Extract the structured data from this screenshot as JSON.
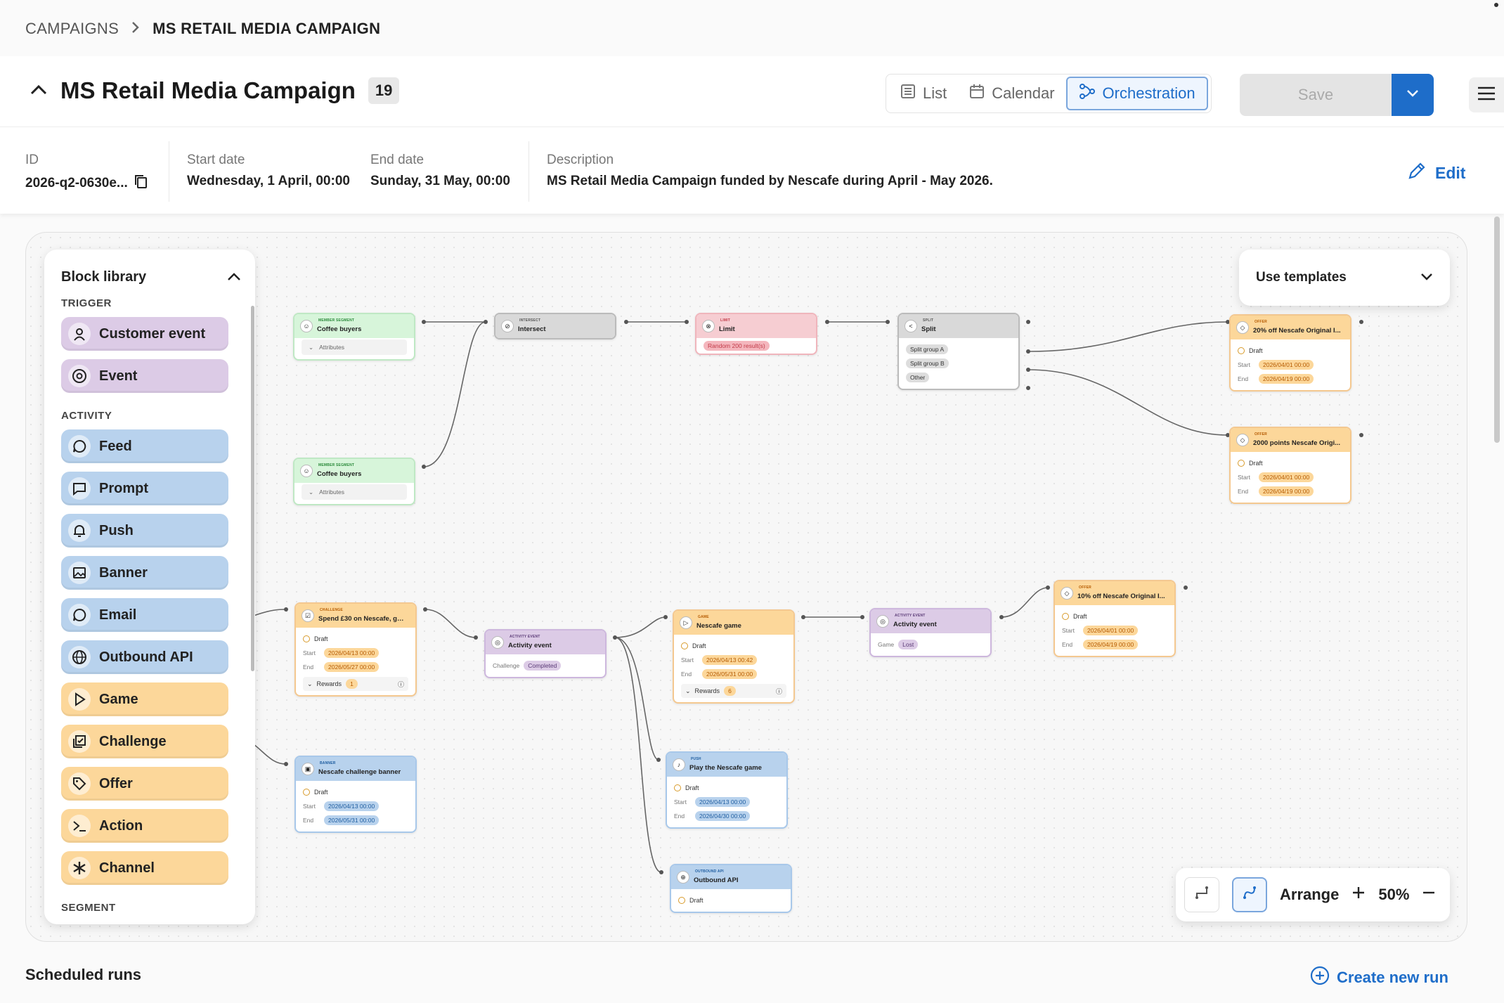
{
  "breadcrumb": {
    "root": "CAMPAIGNS",
    "current": "MS RETAIL MEDIA CAMPAIGN"
  },
  "header": {
    "title": "MS Retail Media Campaign",
    "count": "19",
    "views": [
      "List",
      "Calendar",
      "Orchestration"
    ],
    "save": "Save"
  },
  "info": {
    "id_label": "ID",
    "id_value": "2026-q2-0630e...",
    "start_label": "Start date",
    "start_value": "Wednesday, 1 April, 00:00",
    "end_label": "End date",
    "end_value": "Sunday, 31 May, 00:00",
    "desc_label": "Description",
    "desc_value": "MS Retail Media Campaign funded by Nescafe during April - May 2026.",
    "edit": "Edit"
  },
  "library": {
    "title": "Block library",
    "sections": {
      "trigger": "TRIGGER",
      "activity": "ACTIVITY",
      "segment": "SEGMENT"
    },
    "trigger": [
      "Customer event",
      "Event"
    ],
    "activity": [
      "Feed",
      "Prompt",
      "Push",
      "Banner",
      "Email",
      "Outbound API",
      "Game",
      "Challenge",
      "Offer",
      "Action",
      "Channel"
    ]
  },
  "templates": "Use templates",
  "tools": {
    "arrange": "Arrange",
    "zoom": "50%"
  },
  "nodes": {
    "seg1": {
      "type": "MEMBER SEGMENT",
      "name": "Coffee buyers",
      "attr": "Attributes"
    },
    "seg2": {
      "type": "MEMBER SEGMENT",
      "name": "Coffee buyers",
      "attr": "Attributes"
    },
    "intersect": {
      "type": "INTERSECT",
      "name": "Intersect"
    },
    "limit": {
      "type": "LIMIT",
      "name": "Limit",
      "pill": "Random 200 result(s)"
    },
    "split": {
      "type": "SPLIT",
      "name": "Split",
      "groups": [
        "Split group A",
        "Split group B",
        "Other"
      ]
    },
    "offer1": {
      "type": "OFFER",
      "name": "20% off Nescafe Original I...",
      "status": "Draft",
      "start": "2026/04/01 00:00",
      "end": "2026/04/19 00:00"
    },
    "offer2": {
      "type": "OFFER",
      "name": "2000 points Nescafe Origi...",
      "status": "Draft",
      "start": "2026/04/01 00:00",
      "end": "2026/04/19 00:00"
    },
    "challenge": {
      "type": "CHALLENGE",
      "name": "Spend £30 on Nescafe, ge...",
      "status": "Draft",
      "start": "2026/04/13 00:00",
      "end": "2026/05/27 00:00",
      "rewards": "Rewards",
      "rcount": "1"
    },
    "banner": {
      "type": "BANNER",
      "name": "Nescafe challenge banner",
      "status": "Draft",
      "start": "2026/04/13 00:00",
      "end": "2026/05/31 00:00"
    },
    "act1": {
      "type": "ACTIVITY EVENT",
      "name": "Activity event",
      "label": "Challenge",
      "value": "Completed"
    },
    "game": {
      "type": "GAME",
      "name": "Nescafe game",
      "status": "Draft",
      "start": "2026/04/13 00:42",
      "end": "2026/05/31 00:00",
      "rewards": "Rewards",
      "rcount": "6"
    },
    "push": {
      "type": "PUSH",
      "name": "Play the Nescafe game",
      "status": "Draft",
      "start": "2026/04/13 00:00",
      "end": "2026/04/30 00:00"
    },
    "api": {
      "type": "OUTBOUND API",
      "name": "Outbound API",
      "status": "Draft"
    },
    "act2": {
      "type": "ACTIVITY EVENT",
      "name": "Activity event",
      "label": "Game",
      "value": "Lost"
    },
    "offer3": {
      "type": "OFFER",
      "name": "10% off Nescafe Original I...",
      "status": "Draft",
      "start": "2026/04/01 00:00",
      "end": "2026/04/19 00:00"
    }
  },
  "labels": {
    "start": "Start",
    "end": "End"
  },
  "scheduled": "Scheduled runs",
  "newrun": "Create new run",
  "colors": {
    "accent": "#1e6dc9",
    "trigger": "#dccbe6",
    "activity": "#b8d2ed",
    "game": "#fcd79a"
  }
}
